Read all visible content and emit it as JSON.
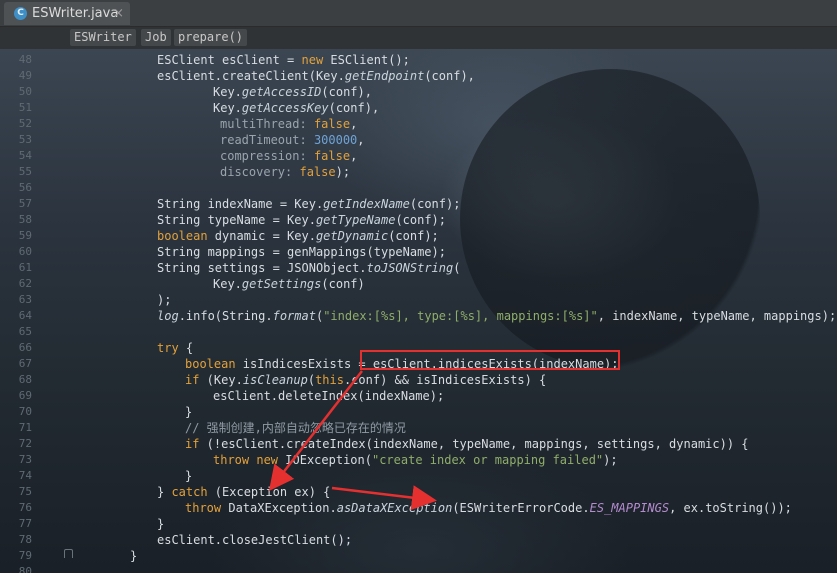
{
  "tab": {
    "title": "ESWriter.java",
    "close": "×",
    "icon_letter": "C"
  },
  "breadcrumb": [
    "ESWriter",
    "Job",
    "prepare()"
  ],
  "line_numbers": [
    "48",
    "49",
    "50",
    "51",
    "52",
    "53",
    "54",
    "55",
    "56",
    "57",
    "58",
    "59",
    "60",
    "61",
    "62",
    "63",
    "64",
    "65",
    "66",
    "67",
    "68",
    "69",
    "70",
    "71",
    "72",
    "73",
    "74",
    "75",
    "76",
    "77",
    "78",
    "79",
    "80"
  ],
  "code": {
    "l48": {
      "a": "ESClient esClient = ",
      "b": "new",
      "c": " ESClient();"
    },
    "l49": {
      "a": "esClient.createClient(Key.",
      "b": "getEndpoint",
      "c": "(conf),"
    },
    "l50": {
      "a": "Key.",
      "b": "getAccessID",
      "c": "(conf),"
    },
    "l51": {
      "a": "Key.",
      "b": "getAccessKey",
      "c": "(conf),"
    },
    "l52": {
      "hint": "multiThread:",
      "val": "false",
      "tail": ","
    },
    "l53": {
      "hint": "readTimeout:",
      "val": "300000",
      "tail": ","
    },
    "l54": {
      "hint": "compression:",
      "val": "false",
      "tail": ","
    },
    "l55": {
      "hint": "discovery:",
      "val": "false",
      "tail": ");"
    },
    "l57": {
      "a": "String indexName = Key.",
      "b": "getIndexName",
      "c": "(conf);"
    },
    "l58": {
      "a": "String typeName = Key.",
      "b": "getTypeName",
      "c": "(conf);"
    },
    "l59": {
      "kw": "boolean",
      "a": " dynamic = Key.",
      "b": "getDynamic",
      "c": "(conf);"
    },
    "l60": {
      "a": "String mappings = genMappings(typeName);"
    },
    "l61": {
      "a": "String settings = JSONObject.",
      "b": "toJSONString",
      "c": "("
    },
    "l62": {
      "a": "Key.",
      "b": "getSettings",
      "c": "(conf)"
    },
    "l63": {
      "a": ");"
    },
    "l64": {
      "a": "log",
      "b": ".info(String.",
      "c": "format",
      "d": "(",
      "s": "\"index:[%s], type:[%s], mappings:[%s]\"",
      "e": ", indexName, typeName, mappings);"
    },
    "l66": {
      "kw": "try",
      "a": " {"
    },
    "l67": {
      "kw": "boolean",
      "a": " isIndicesExists = ",
      "b": "esClient.indicesExists(indexName);"
    },
    "l68": {
      "kw": "if",
      "a": " (Key.",
      "b": "isCleanup",
      "c": "(",
      "kw2": "this",
      "d": ".conf) && isIndicesExists) {"
    },
    "l69": {
      "a": "esClient.deleteIndex(indexName);"
    },
    "l70": {
      "a": "}"
    },
    "l71": {
      "a": "// 强制创建,内部自动忽略已存在的情况"
    },
    "l72": {
      "kw": "if",
      "a": " (!esClient.createIndex(indexName, typeName, mappings, settings, dynamic)) {"
    },
    "l73": {
      "kw": "throw",
      "kw2": "new",
      "a": " IOException(",
      "s": "\"create index or mapping failed\"",
      "b": ");"
    },
    "l74": {
      "a": "}"
    },
    "l75": {
      "a": "} ",
      "kw": "catch",
      "b": " (Exception ex) {"
    },
    "l76": {
      "kw": "throw",
      "a": " DataXException.",
      "b": "asDataXException",
      "c": "(ESWriterErrorCode.",
      "cst": "ES_MAPPINGS",
      "d": ", ex.toString());"
    },
    "l77": {
      "a": "}"
    },
    "l78": {
      "a": "esClient.closeJestClient();"
    },
    "l79": {
      "a": "}"
    }
  },
  "annotation_color": "#e53030"
}
